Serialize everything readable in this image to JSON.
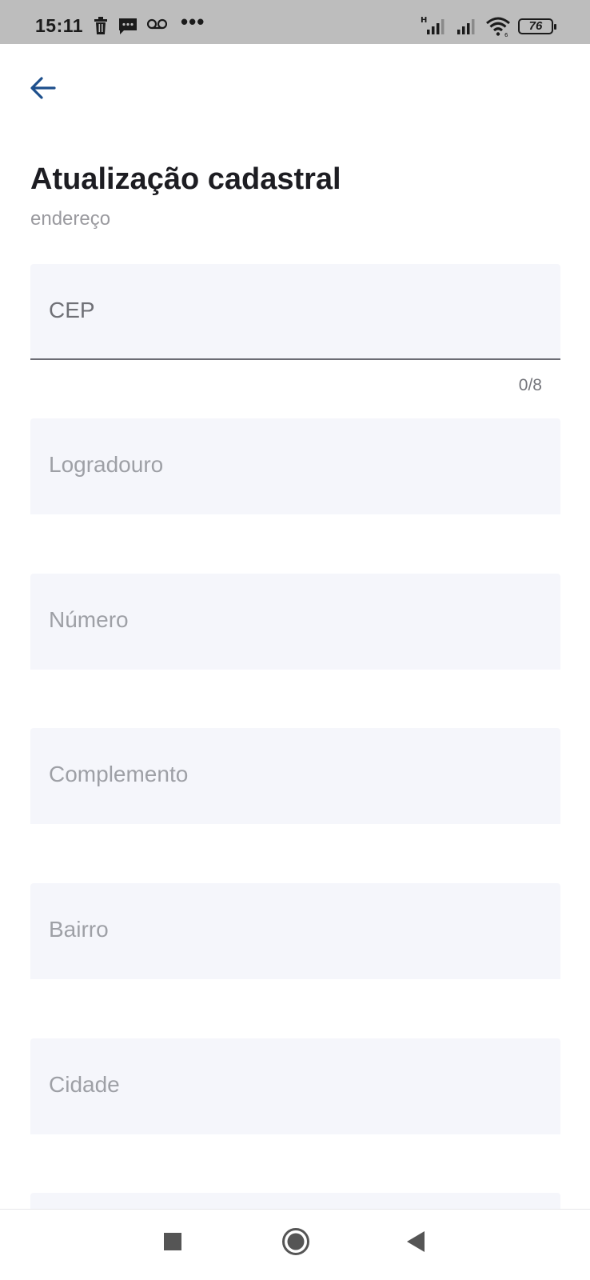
{
  "status_bar": {
    "time": "15:11",
    "icons": [
      "trash-icon",
      "message-icon",
      "voicemail-icon",
      "more-icon",
      "signal-h-icon",
      "signal-icon",
      "wifi-icon",
      "battery-icon"
    ],
    "more": "•••",
    "battery_level": "76"
  },
  "header": {
    "back_icon": "arrow-left-icon",
    "accent_color": "#1d4f8c"
  },
  "page": {
    "title": "Atualização cadastral",
    "subtitle": "endereço"
  },
  "form": {
    "fields": [
      {
        "label": "CEP",
        "counter": "0/8"
      },
      {
        "label": "Logradouro"
      },
      {
        "label": "Número"
      },
      {
        "label": "Complemento"
      },
      {
        "label": "Bairro"
      },
      {
        "label": "Cidade"
      }
    ]
  },
  "nav_bar": {
    "icons": [
      "square-recents-icon",
      "circle-home-icon",
      "triangle-back-icon"
    ]
  }
}
